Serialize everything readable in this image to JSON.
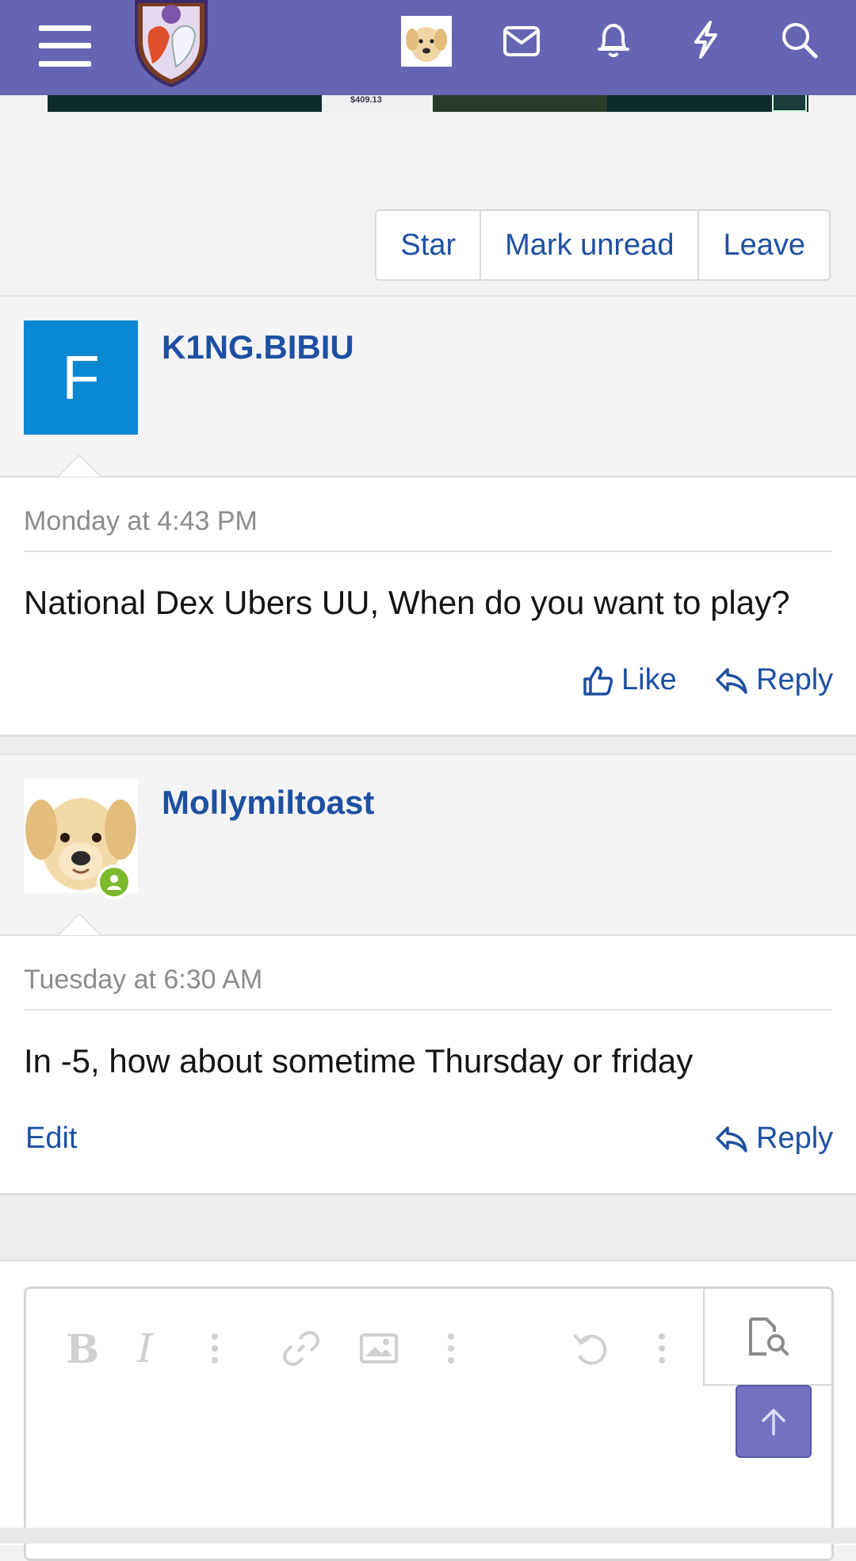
{
  "header": {
    "icons": [
      "menu-icon",
      "site-logo",
      "user-avatar",
      "inbox-icon",
      "bell-icon",
      "bolt-icon",
      "search-icon"
    ],
    "accent": "#6665b3"
  },
  "ad": {
    "price": "$409.13"
  },
  "conversation_actions": {
    "star": "Star",
    "mark_unread": "Mark unread",
    "leave": "Leave"
  },
  "messages": [
    {
      "author": "K1NG.BIBIU",
      "avatar_letter": "F",
      "timestamp": "Monday at 4:43 PM",
      "text": "National Dex Ubers UU, When do you want to play?",
      "like_label": "Like",
      "reply_label": "Reply"
    },
    {
      "author": "Mollymiltoast",
      "timestamp": "Tuesday at 6:30 AM",
      "text": "In -5, how about sometime Thursday or friday",
      "edit_label": "Edit",
      "reply_label": "Reply"
    }
  ],
  "editor": {
    "toolbar_icons": [
      "bold-icon",
      "italic-icon",
      "more-options-icon",
      "link-icon",
      "image-icon",
      "more-options-icon",
      "undo-icon",
      "more-options-icon",
      "preview-icon"
    ]
  }
}
